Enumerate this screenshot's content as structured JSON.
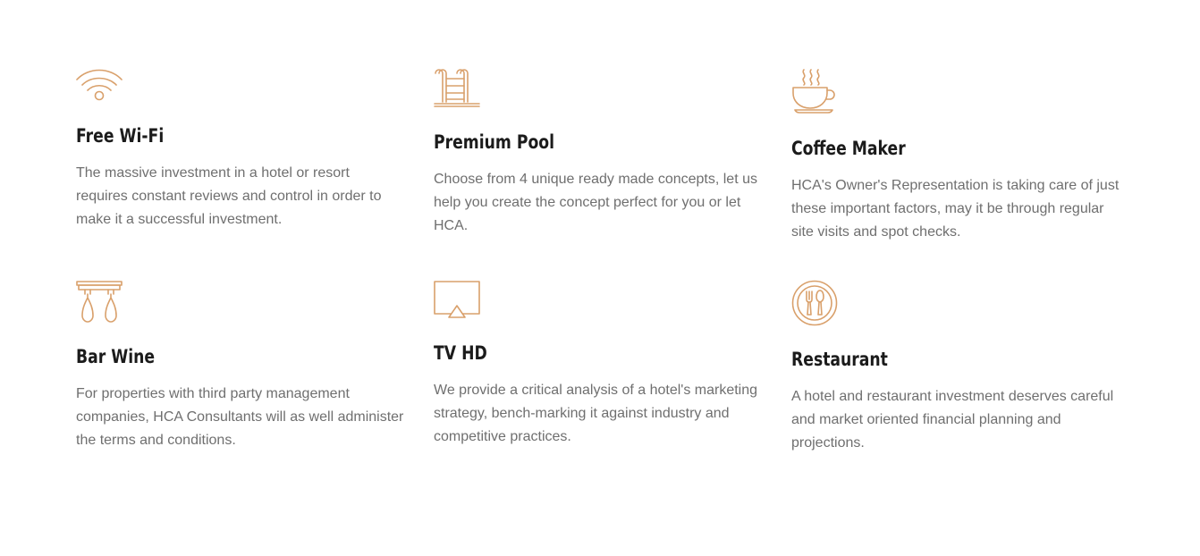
{
  "colors": {
    "accent": "#d9a06b",
    "title": "#1b1b1b",
    "body": "#6f6f6f",
    "background": "#ffffff"
  },
  "features": [
    {
      "icon": "wifi-icon",
      "title": "Free Wi-Fi",
      "description": "The massive investment in a hotel or resort requires constant reviews and control in order to make it a successful investment."
    },
    {
      "icon": "pool-ladder-icon",
      "title": "Premium Pool",
      "description": "Choose from 4 unique ready made concepts, let us help you create the concept perfect for you or let HCA."
    },
    {
      "icon": "coffee-cup-icon",
      "title": "Coffee Maker",
      "description": "HCA's Owner's Representation is taking care of just these important factors, may it be through regular site visits and spot checks."
    },
    {
      "icon": "wine-glasses-icon",
      "title": "Bar Wine",
      "description": "For properties with third party management companies, HCA Consultants will as well administer the terms and conditions."
    },
    {
      "icon": "tv-icon",
      "title": "TV HD",
      "description": "We provide a critical analysis of a hotel's marketing strategy, bench-marking it against industry and competitive practices."
    },
    {
      "icon": "restaurant-icon",
      "title": "Restaurant",
      "description": "A hotel and restaurant investment deserves careful and market oriented financial planning and projections."
    }
  ]
}
